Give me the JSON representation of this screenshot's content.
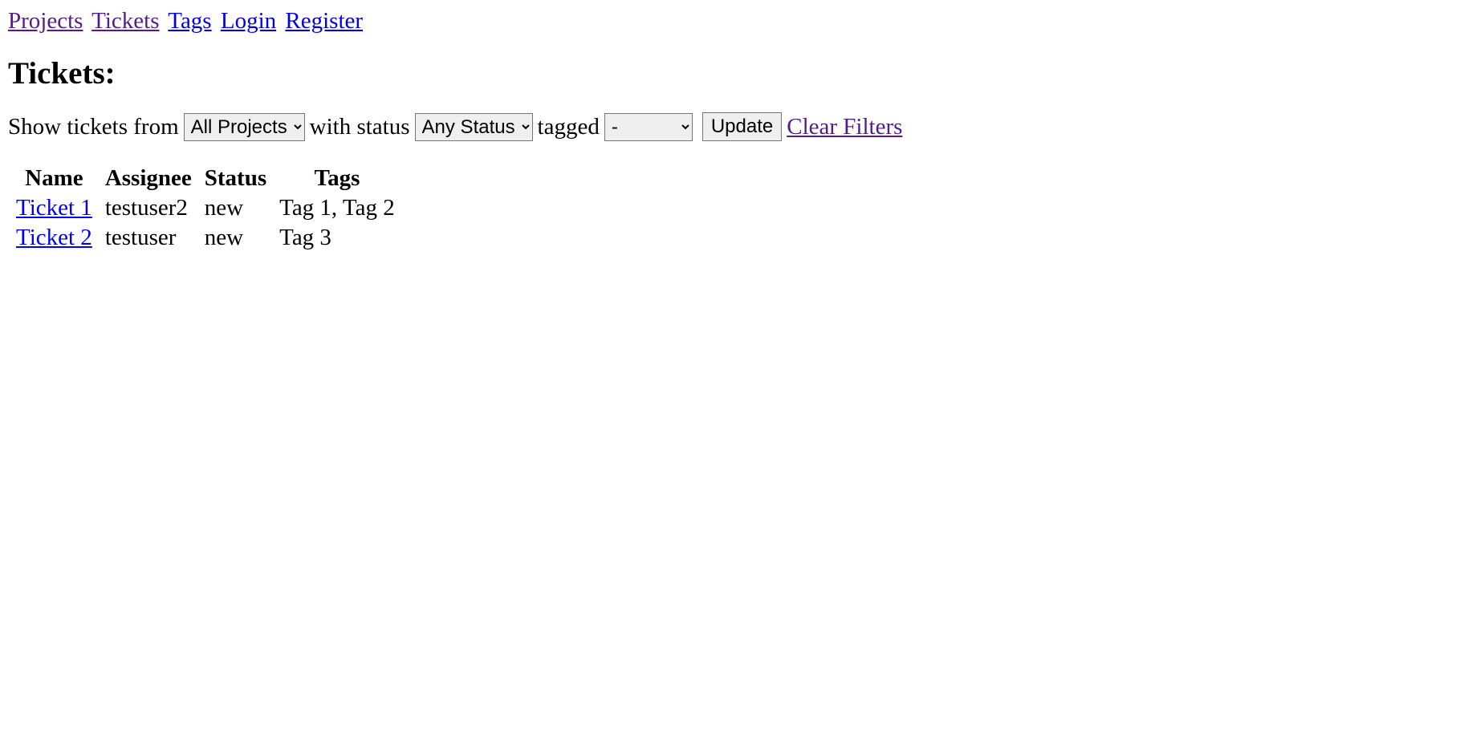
{
  "nav": {
    "projects": "Projects",
    "tickets": "Tickets",
    "tags": "Tags",
    "login": "Login",
    "register": "Register"
  },
  "heading": "Tickets:",
  "filter": {
    "text_show": "Show tickets from",
    "project_selected": "All Projects",
    "text_with_status": "with status",
    "status_selected": "Any Status",
    "text_tagged": "tagged",
    "tag_selected": "-",
    "update_label": "Update",
    "clear_label": "Clear Filters"
  },
  "table": {
    "headers": {
      "name": "Name",
      "assignee": "Assignee",
      "status": "Status",
      "tags": "Tags"
    },
    "rows": [
      {
        "name": "Ticket 1",
        "assignee": "testuser2",
        "status": "new",
        "tags": "Tag 1, Tag 2"
      },
      {
        "name": "Ticket 2",
        "assignee": "testuser",
        "status": "new",
        "tags": "Tag 3"
      }
    ]
  }
}
